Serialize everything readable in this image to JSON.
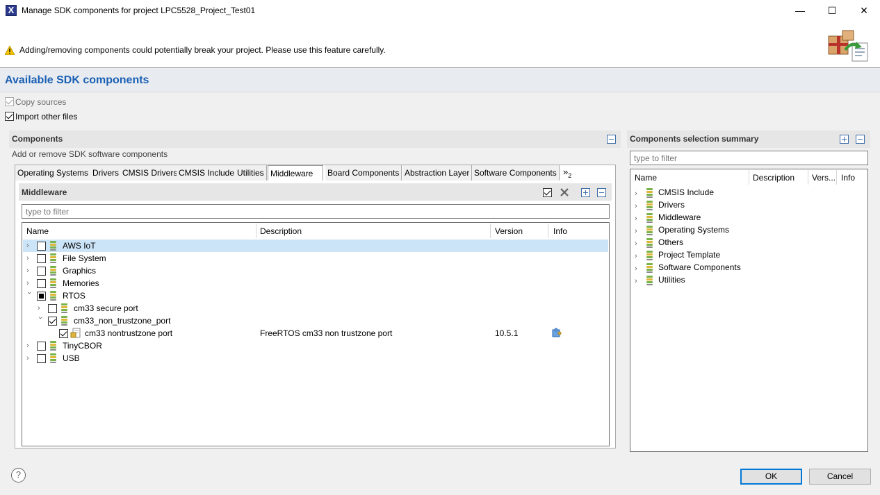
{
  "window": {
    "title": "Manage SDK components for project LPC5528_Project_Test01",
    "app_icon_glyph": "X",
    "minimize_glyph": "—",
    "maximize_glyph": "☐",
    "close_glyph": "✕"
  },
  "banner": {
    "warning_text": "Adding/removing components could potentially break your project. Please use this feature carefully."
  },
  "section": {
    "title": "Available SDK components"
  },
  "options": {
    "copy_sources": "Copy sources",
    "import_other_files": "Import other files"
  },
  "components_panel": {
    "header": "Components",
    "description": "Add or remove SDK software components",
    "tabs": [
      "Operating Systems",
      "Drivers",
      "CMSIS Drivers",
      "CMSIS Include",
      "Utilities",
      "Middleware",
      "Board Components",
      "Abstraction Layer",
      "Software Components"
    ],
    "overflow_label": "»",
    "overflow_count": "2",
    "active_tab": "Middleware",
    "middleware": {
      "header": "Middleware",
      "filter_placeholder": "type to filter",
      "columns": {
        "name": "Name",
        "description": "Description",
        "version": "Version",
        "info": "Info"
      },
      "rows": [
        {
          "name": "AWS IoT",
          "description": "",
          "version": ""
        },
        {
          "name": "File System",
          "description": "",
          "version": ""
        },
        {
          "name": "Graphics",
          "description": "",
          "version": ""
        },
        {
          "name": "Memories",
          "description": "",
          "version": ""
        },
        {
          "name": "RTOS",
          "description": "",
          "version": ""
        },
        {
          "name": "cm33 secure port",
          "description": "",
          "version": ""
        },
        {
          "name": "cm33_non_trustzone_port",
          "description": "",
          "version": ""
        },
        {
          "name": "cm33 nontrustzone port",
          "description": "FreeRTOS cm33 non trustzone port",
          "version": "10.5.1"
        },
        {
          "name": "TinyCBOR",
          "description": "",
          "version": ""
        },
        {
          "name": "USB",
          "description": "",
          "version": ""
        }
      ]
    }
  },
  "summary_panel": {
    "header": "Components selection summary",
    "filter_placeholder": "type to filter",
    "columns": {
      "name": "Name",
      "description": "Description",
      "version": "Vers...",
      "info": "Info"
    },
    "items": [
      "CMSIS Include",
      "Drivers",
      "Middleware",
      "Operating Systems",
      "Others",
      "Project Template",
      "Software Components",
      "Utilities"
    ]
  },
  "footer": {
    "help_glyph": "?",
    "ok_label": "OK",
    "cancel_label": "Cancel"
  },
  "colors": {
    "section_title": "#1a5fb4",
    "selected_row": "#cce4f7",
    "default_button_border": "#0078d7"
  }
}
